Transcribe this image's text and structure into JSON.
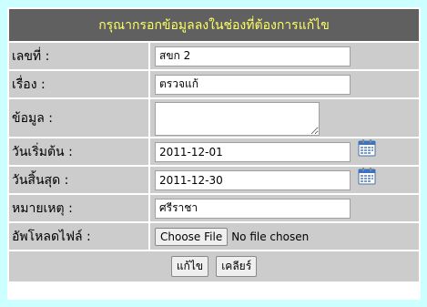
{
  "form": {
    "title": "กรุณากรอกข้อมูลลงในช่องที่ต้องการแก้ไข",
    "labels": {
      "number": "เลขที่ :",
      "subject": "เรื่อง :",
      "detail": "ข้อมูล :",
      "start_date": "วันเริ่มต้น :",
      "end_date": "วันสิ้นสุด :",
      "note": "หมายเหตุ :",
      "upload": "อัพโหลดไฟล์ :"
    },
    "values": {
      "number": "สขก 2",
      "subject": "ตรวจแก้",
      "detail": "",
      "start_date": "2011-12-01",
      "end_date": "2011-12-30",
      "note": "ศรีราชา"
    },
    "upload": {
      "button_label": "Choose File",
      "status": "No file chosen"
    },
    "buttons": {
      "edit": "แก้ไข",
      "clear": "เคลียร์"
    }
  },
  "icons": {
    "start_calendar": "calendar-icon",
    "end_calendar": "calendar-icon"
  },
  "colors": {
    "page_background": "#ccffff",
    "title_background": "#606060",
    "title_text": "#ffff66",
    "cell_background": "#cccccc"
  }
}
